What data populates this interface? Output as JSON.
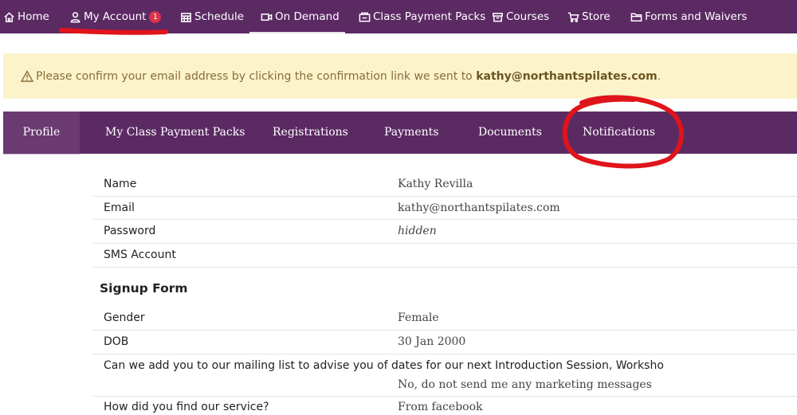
{
  "nav": {
    "items": [
      {
        "label": "Home",
        "icon": "home-icon"
      },
      {
        "label": "My Account",
        "icon": "user-icon",
        "badge": "1"
      },
      {
        "label": "Schedule",
        "icon": "calendar-icon"
      },
      {
        "label": "On Demand",
        "icon": "video-icon"
      },
      {
        "label": "Class Payment Packs",
        "icon": "ticket-icon"
      },
      {
        "label": "Courses",
        "icon": "box-icon"
      },
      {
        "label": "Store",
        "icon": "cart-icon"
      },
      {
        "label": "Forms and Waivers",
        "icon": "folder-icon"
      }
    ],
    "active": "On Demand"
  },
  "alert": {
    "text": "Please confirm your email address by clicking the confirmation link we sent to ",
    "email": "kathy@northantspilates.com",
    "suffix": "."
  },
  "tabs": [
    "Profile",
    "My Class Payment Packs",
    "Registrations",
    "Payments",
    "Documents",
    "Notifications"
  ],
  "active_tab": "Profile",
  "profile": [
    {
      "label": "Name",
      "value": "Kathy Revilla"
    },
    {
      "label": "Email",
      "value": "kathy@northantspilates.com"
    },
    {
      "label": "Password",
      "value": "hidden"
    },
    {
      "label": "SMS Account",
      "value": ""
    }
  ],
  "signup": {
    "title": "Signup Form",
    "fields": [
      {
        "label": "Gender",
        "value": "Female"
      },
      {
        "label": "DOB",
        "value": "30 Jan 2000"
      },
      {
        "label": "Can we add you to our mailing list to advise you of dates for our next Introduction Session, Worksho",
        "value": "No, do not send me any marketing messages"
      },
      {
        "label": "How did you find our service?",
        "value": "From facebook"
      }
    ]
  },
  "colors": {
    "nav_bg": "#5b2a63",
    "alert_bg": "#fcf3cb",
    "annotation": "#e0141b"
  }
}
